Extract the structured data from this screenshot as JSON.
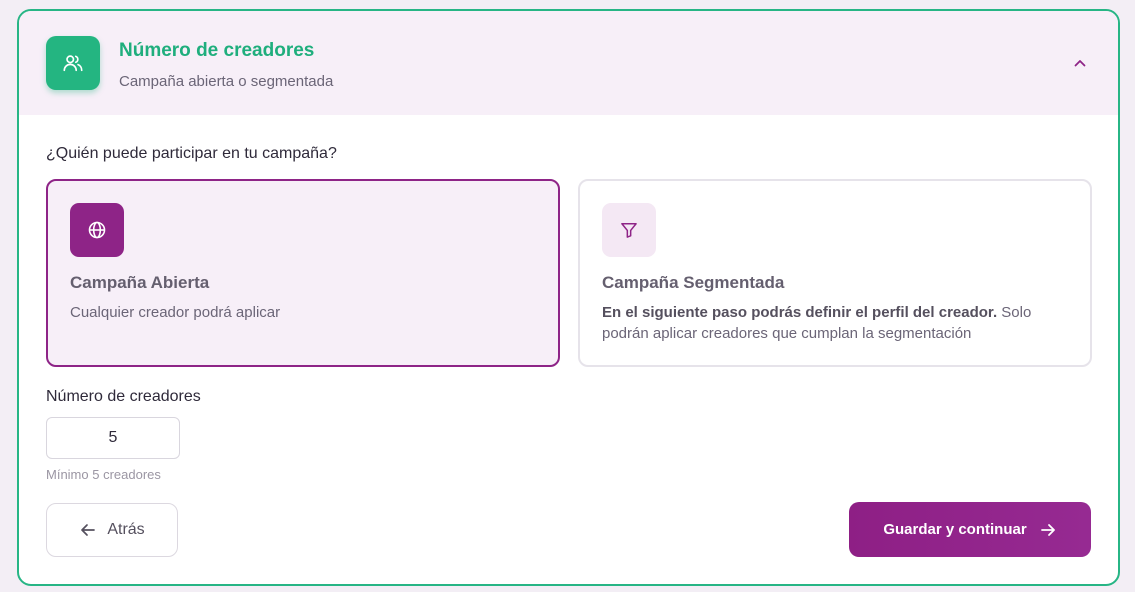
{
  "header": {
    "icon": "users-icon",
    "title": "Número de creadores",
    "subtitle": "Campaña abierta o segmentada",
    "toggle_icon": "chevron-up-icon"
  },
  "question": "¿Quién puede participar en tu campaña?",
  "options": [
    {
      "icon": "globe-icon",
      "title": "Campaña Abierta",
      "description": "Cualquier creador podrá aplicar",
      "selected": true
    },
    {
      "icon": "filter-icon",
      "title": "Campaña Segmentada",
      "description_bold": "En el siguiente paso podrás definir el perfil del creador.",
      "description": " Solo podrán aplicar creadores que cumplan la segmentación",
      "selected": false
    }
  ],
  "creators": {
    "label": "Número de creadores",
    "value": "5",
    "hint": "Mínimo 5 creadores"
  },
  "actions": {
    "back_label": "Atrás",
    "back_icon": "arrow-left-icon",
    "save_label": "Guardar y continuar",
    "save_icon": "arrow-right-icon"
  },
  "colors": {
    "accent_green": "#24b581",
    "accent_purple": "#8e2487",
    "header_bg": "#f7eff8"
  }
}
